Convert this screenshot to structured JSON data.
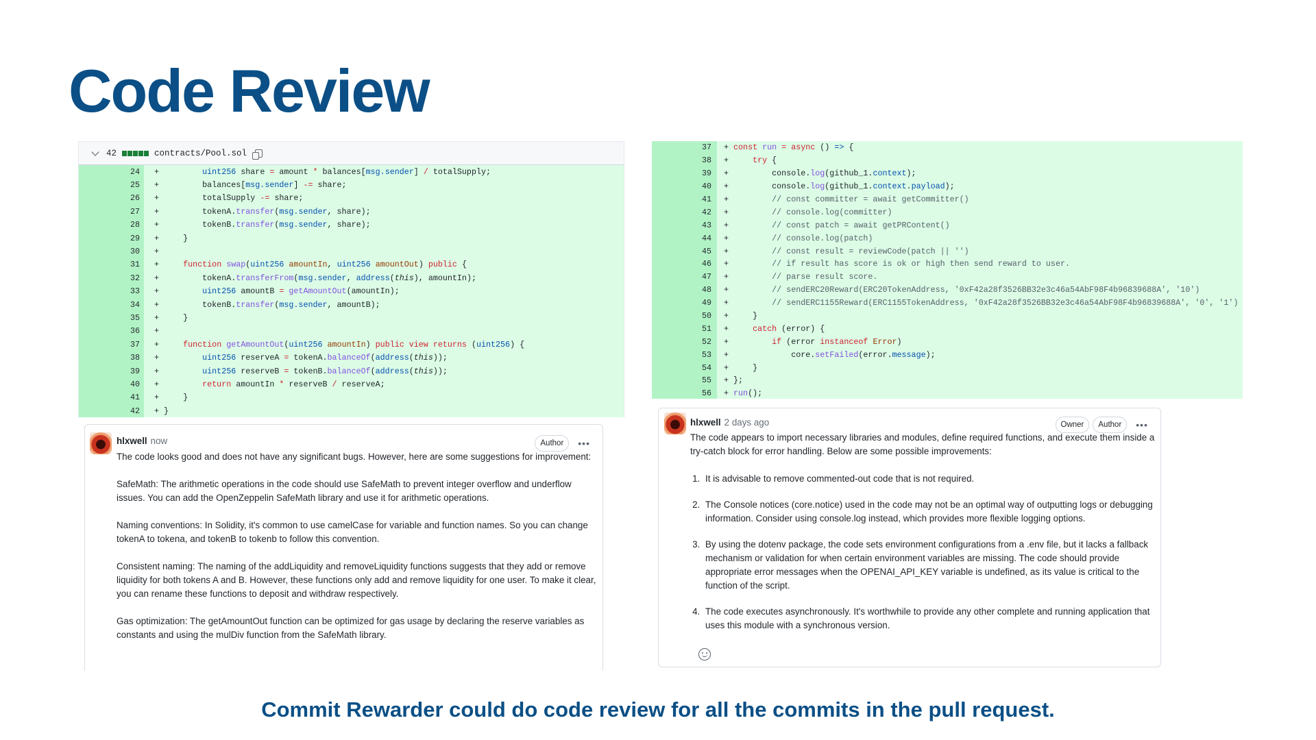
{
  "slide": {
    "title": "Code Review",
    "caption": "Commit Rewarder could do code review for all the commits in the pull request."
  },
  "left_diff": {
    "changes": "42",
    "filename": "contracts/Pool.sol",
    "lines": [
      {
        "n": "24",
        "tokens": [
          [
            "n",
            "        "
          ],
          [
            "t",
            "uint256"
          ],
          [
            "n",
            " share "
          ],
          [
            "o",
            "="
          ],
          [
            "n",
            " amount "
          ],
          [
            "o",
            "*"
          ],
          [
            "n",
            " balances["
          ],
          [
            "t",
            "msg.sender"
          ],
          [
            "n",
            "] "
          ],
          [
            "o",
            "/"
          ],
          [
            "n",
            " totalSupply;"
          ]
        ]
      },
      {
        "n": "25",
        "tokens": [
          [
            "n",
            "        balances["
          ],
          [
            "t",
            "msg.sender"
          ],
          [
            "n",
            "] "
          ],
          [
            "o",
            "-="
          ],
          [
            "n",
            " share;"
          ]
        ]
      },
      {
        "n": "26",
        "tokens": [
          [
            "n",
            "        totalSupply "
          ],
          [
            "o",
            "-="
          ],
          [
            "n",
            " share;"
          ]
        ]
      },
      {
        "n": "27",
        "tokens": [
          [
            "n",
            "        tokenA."
          ],
          [
            "f",
            "transfer"
          ],
          [
            "n",
            "("
          ],
          [
            "t",
            "msg.sender"
          ],
          [
            "n",
            ", share);"
          ]
        ]
      },
      {
        "n": "28",
        "tokens": [
          [
            "n",
            "        tokenB."
          ],
          [
            "f",
            "transfer"
          ],
          [
            "n",
            "("
          ],
          [
            "t",
            "msg.sender"
          ],
          [
            "n",
            ", share);"
          ]
        ]
      },
      {
        "n": "29",
        "tokens": [
          [
            "n",
            "    }"
          ]
        ]
      },
      {
        "n": "30",
        "tokens": []
      },
      {
        "n": "31",
        "tokens": [
          [
            "n",
            "    "
          ],
          [
            "k",
            "function"
          ],
          [
            "n",
            " "
          ],
          [
            "f",
            "swap"
          ],
          [
            "n",
            "("
          ],
          [
            "t",
            "uint256"
          ],
          [
            "n",
            " "
          ],
          [
            "p",
            "amountIn"
          ],
          [
            "n",
            ", "
          ],
          [
            "t",
            "uint256"
          ],
          [
            "n",
            " "
          ],
          [
            "p",
            "amountOut"
          ],
          [
            "n",
            ") "
          ],
          [
            "k",
            "public"
          ],
          [
            "n",
            " {"
          ]
        ]
      },
      {
        "n": "32",
        "tokens": [
          [
            "n",
            "        tokenA."
          ],
          [
            "f",
            "transferFrom"
          ],
          [
            "n",
            "("
          ],
          [
            "t",
            "msg.sender"
          ],
          [
            "n",
            ", "
          ],
          [
            "t",
            "address"
          ],
          [
            "n",
            "("
          ],
          [
            "i",
            "this"
          ],
          [
            "n",
            "), amountIn);"
          ]
        ]
      },
      {
        "n": "33",
        "tokens": [
          [
            "n",
            "        "
          ],
          [
            "t",
            "uint256"
          ],
          [
            "n",
            " amountB "
          ],
          [
            "o",
            "="
          ],
          [
            "n",
            " "
          ],
          [
            "f",
            "getAmountOut"
          ],
          [
            "n",
            "(amountIn);"
          ]
        ]
      },
      {
        "n": "34",
        "tokens": [
          [
            "n",
            "        tokenB."
          ],
          [
            "f",
            "transfer"
          ],
          [
            "n",
            "("
          ],
          [
            "t",
            "msg.sender"
          ],
          [
            "n",
            ", amountB);"
          ]
        ]
      },
      {
        "n": "35",
        "tokens": [
          [
            "n",
            "    }"
          ]
        ]
      },
      {
        "n": "36",
        "tokens": []
      },
      {
        "n": "37",
        "tokens": [
          [
            "n",
            "    "
          ],
          [
            "k",
            "function"
          ],
          [
            "n",
            " "
          ],
          [
            "f",
            "getAmountOut"
          ],
          [
            "n",
            "("
          ],
          [
            "t",
            "uint256"
          ],
          [
            "n",
            " "
          ],
          [
            "p",
            "amountIn"
          ],
          [
            "n",
            ") "
          ],
          [
            "k",
            "public view returns"
          ],
          [
            "n",
            " ("
          ],
          [
            "t",
            "uint256"
          ],
          [
            "n",
            ") {"
          ]
        ]
      },
      {
        "n": "38",
        "tokens": [
          [
            "n",
            "        "
          ],
          [
            "t",
            "uint256"
          ],
          [
            "n",
            " reserveA "
          ],
          [
            "o",
            "="
          ],
          [
            "n",
            " tokenA."
          ],
          [
            "f",
            "balanceOf"
          ],
          [
            "n",
            "("
          ],
          [
            "t",
            "address"
          ],
          [
            "n",
            "("
          ],
          [
            "i",
            "this"
          ],
          [
            "n",
            "));"
          ]
        ]
      },
      {
        "n": "39",
        "tokens": [
          [
            "n",
            "        "
          ],
          [
            "t",
            "uint256"
          ],
          [
            "n",
            " reserveB "
          ],
          [
            "o",
            "="
          ],
          [
            "n",
            " tokenB."
          ],
          [
            "f",
            "balanceOf"
          ],
          [
            "n",
            "("
          ],
          [
            "t",
            "address"
          ],
          [
            "n",
            "("
          ],
          [
            "i",
            "this"
          ],
          [
            "n",
            "));"
          ]
        ]
      },
      {
        "n": "40",
        "tokens": [
          [
            "n",
            "        "
          ],
          [
            "k",
            "return"
          ],
          [
            "n",
            " amountIn "
          ],
          [
            "o",
            "*"
          ],
          [
            "n",
            " reserveB "
          ],
          [
            "o",
            "/"
          ],
          [
            "n",
            " reserveA;"
          ]
        ]
      },
      {
        "n": "41",
        "tokens": [
          [
            "n",
            "    }"
          ]
        ]
      },
      {
        "n": "42",
        "tokens": [
          [
            "n",
            "}"
          ]
        ]
      }
    ]
  },
  "right_diff": {
    "lines": [
      {
        "n": "37",
        "tokens": [
          [
            "k",
            "const"
          ],
          [
            "n",
            " "
          ],
          [
            "f",
            "run"
          ],
          [
            "n",
            " "
          ],
          [
            "o",
            "="
          ],
          [
            "n",
            " "
          ],
          [
            "k",
            "async"
          ],
          [
            "n",
            " () "
          ],
          [
            "t",
            "=>"
          ],
          [
            "n",
            " {"
          ]
        ]
      },
      {
        "n": "38",
        "tokens": [
          [
            "n",
            "    "
          ],
          [
            "k",
            "try"
          ],
          [
            "n",
            " {"
          ]
        ]
      },
      {
        "n": "39",
        "tokens": [
          [
            "n",
            "        console."
          ],
          [
            "f",
            "log"
          ],
          [
            "n",
            "(github_1."
          ],
          [
            "t",
            "context"
          ],
          [
            "n",
            ");"
          ]
        ]
      },
      {
        "n": "40",
        "tokens": [
          [
            "n",
            "        console."
          ],
          [
            "f",
            "log"
          ],
          [
            "n",
            "(github_1."
          ],
          [
            "t",
            "context"
          ],
          [
            "n",
            "."
          ],
          [
            "t",
            "payload"
          ],
          [
            "n",
            ");"
          ]
        ]
      },
      {
        "n": "41",
        "tokens": [
          [
            "n",
            "        "
          ],
          [
            "c",
            "// const committer = await getCommitter()"
          ]
        ]
      },
      {
        "n": "42",
        "tokens": [
          [
            "n",
            "        "
          ],
          [
            "c",
            "// console.log(committer)"
          ]
        ]
      },
      {
        "n": "43",
        "tokens": [
          [
            "n",
            "        "
          ],
          [
            "c",
            "// const patch = await getPRContent()"
          ]
        ]
      },
      {
        "n": "44",
        "tokens": [
          [
            "n",
            "        "
          ],
          [
            "c",
            "// console.log(patch)"
          ]
        ]
      },
      {
        "n": "45",
        "tokens": [
          [
            "n",
            "        "
          ],
          [
            "c",
            "// const result = reviewCode(patch || '')"
          ]
        ]
      },
      {
        "n": "46",
        "tokens": [
          [
            "n",
            "        "
          ],
          [
            "c",
            "// if result has score is ok or high then send reward to user."
          ]
        ]
      },
      {
        "n": "47",
        "tokens": [
          [
            "n",
            "        "
          ],
          [
            "c",
            "// parse result score."
          ]
        ]
      },
      {
        "n": "48",
        "tokens": [
          [
            "n",
            "        "
          ],
          [
            "c",
            "// sendERC20Reward(ERC20TokenAddress, '0xF42a28f3526BB32e3c46a54AbF98F4b96839688A', '10')"
          ]
        ]
      },
      {
        "n": "49",
        "tokens": [
          [
            "n",
            "        "
          ],
          [
            "c",
            "// sendERC1155Reward(ERC1155TokenAddress, '0xF42a28f3526BB32e3c46a54AbF98F4b96839688A', '0', '1')"
          ]
        ]
      },
      {
        "n": "50",
        "tokens": [
          [
            "n",
            "    }"
          ]
        ]
      },
      {
        "n": "51",
        "tokens": [
          [
            "n",
            "    "
          ],
          [
            "k",
            "catch"
          ],
          [
            "n",
            " (error) {"
          ]
        ]
      },
      {
        "n": "52",
        "tokens": [
          [
            "n",
            "        "
          ],
          [
            "k",
            "if"
          ],
          [
            "n",
            " (error "
          ],
          [
            "k",
            "instanceof"
          ],
          [
            "n",
            " "
          ],
          [
            "p",
            "Error"
          ],
          [
            "n",
            ")"
          ]
        ]
      },
      {
        "n": "53",
        "tokens": [
          [
            "n",
            "            core."
          ],
          [
            "f",
            "setFailed"
          ],
          [
            "n",
            "(error."
          ],
          [
            "t",
            "message"
          ],
          [
            "n",
            ");"
          ]
        ]
      },
      {
        "n": "54",
        "tokens": [
          [
            "n",
            "    }"
          ]
        ]
      },
      {
        "n": "55",
        "tokens": [
          [
            "n",
            "};"
          ]
        ]
      },
      {
        "n": "56",
        "tokens": [
          [
            "f",
            "run"
          ],
          [
            "n",
            "();"
          ]
        ]
      }
    ]
  },
  "left_comment": {
    "user": "hlxwell",
    "time": "now",
    "badges": [
      "Author"
    ],
    "paragraphs": [
      "The code looks good and does not have any significant bugs. However, here are some suggestions for improvement:",
      "SafeMath: The arithmetic operations in the code should use SafeMath to prevent integer overflow and underflow issues. You can add the OpenZeppelin SafeMath library and use it for arithmetic operations.",
      "Naming conventions: In Solidity, it's common to use camelCase for variable and function names. So you can change tokenA to tokena, and tokenB to tokenb to follow this convention.",
      "Consistent naming: The naming of the addLiquidity and removeLiquidity functions suggests that they add or remove liquidity for both tokens A and B. However, these functions only add and remove liquidity for one user. To make it clear, you can rename these functions to deposit and withdraw respectively.",
      "Gas optimization: The getAmountOut function can be optimized for gas usage by declaring the reserve variables as constants and using the mulDiv function from the SafeMath library."
    ]
  },
  "right_comment": {
    "user": "hlxwell",
    "time": "2 days ago",
    "badges": [
      "Owner",
      "Author"
    ],
    "intro": "The code appears to import necessary libraries and modules, define required functions, and execute them inside a try-catch block for error handling. Below are some possible improvements:",
    "items": [
      "It is advisable to remove commented-out code that is not required.",
      "The Console notices (core.notice) used in the code may not be an optimal way of outputting logs or debugging information. Consider using console.log instead, which provides more flexible logging options.",
      "By using the dotenv package, the code sets environment configurations from a .env file, but it lacks a fallback mechanism or validation for when certain environment variables are missing. The code should provide appropriate error messages when the OPENAI_API_KEY variable is undefined, as its value is critical to the function of the script.",
      "The code executes asynchronously. It's worthwhile to provide any other complete and running application that uses this module with a synchronous version."
    ]
  },
  "colors": {
    "title": "#0b4f86",
    "added_bg": "#dcfce6",
    "added_gutter": "#b2f3c6",
    "keyword": "#cf222e",
    "type": "#0550ae",
    "function": "#8250df"
  }
}
